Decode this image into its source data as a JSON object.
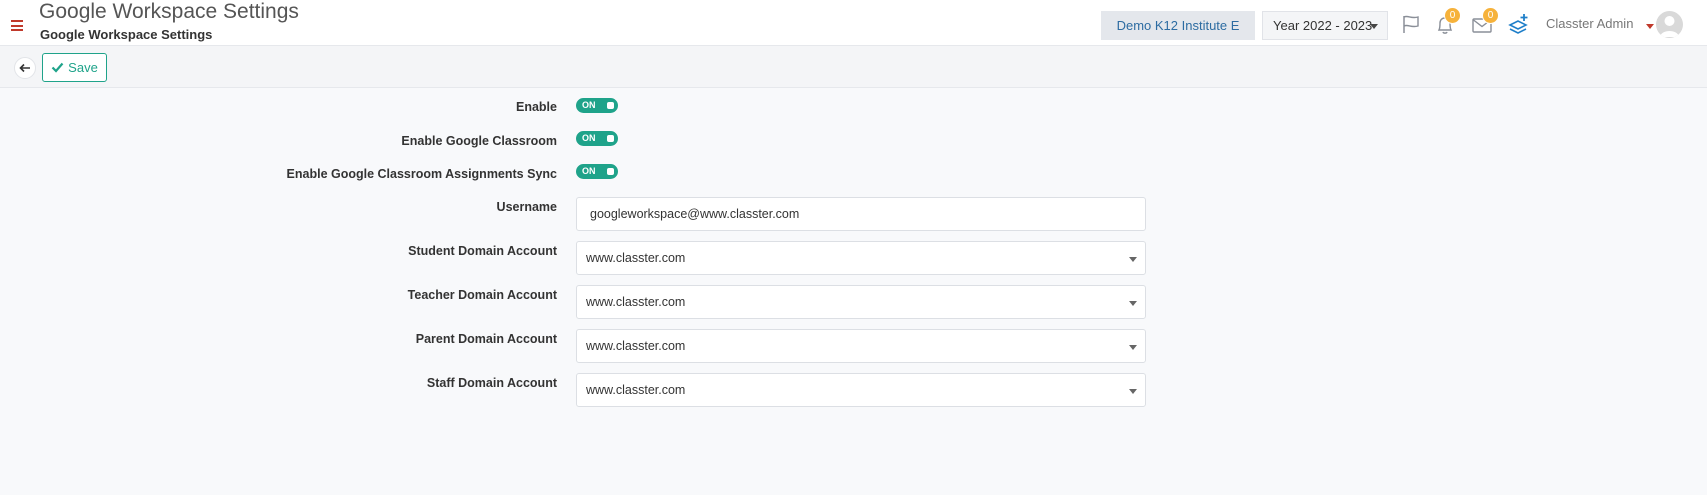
{
  "header": {
    "title": "Google Workspace Settings",
    "subtitle": "Google Workspace Settings",
    "institute": "Demo K12 Institute E",
    "year": "Year 2022 - 2023",
    "notifications_count": "0",
    "messages_count": "0",
    "user_name": "Classter Admin",
    "colors": {
      "menu_accent": "#c0392b",
      "badge": "#f6b23b",
      "institute_text": "#2d6ca2"
    }
  },
  "toolbar": {
    "save_label": "Save",
    "accent": "#1fa38a"
  },
  "form": {
    "toggles": [
      {
        "label": "Enable",
        "state": "ON"
      },
      {
        "label": "Enable Google Classroom",
        "state": "ON"
      },
      {
        "label": "Enable Google Classroom Assignments Sync",
        "state": "ON"
      }
    ],
    "username": {
      "label": "Username",
      "value": "googleworkspace@www.classter.com"
    },
    "selects": [
      {
        "label": "Student Domain Account",
        "value": "www.classter.com"
      },
      {
        "label": "Teacher Domain Account",
        "value": "www.classter.com"
      },
      {
        "label": "Parent Domain Account",
        "value": "www.classter.com"
      },
      {
        "label": "Staff Domain Account",
        "value": "www.classter.com"
      }
    ]
  }
}
